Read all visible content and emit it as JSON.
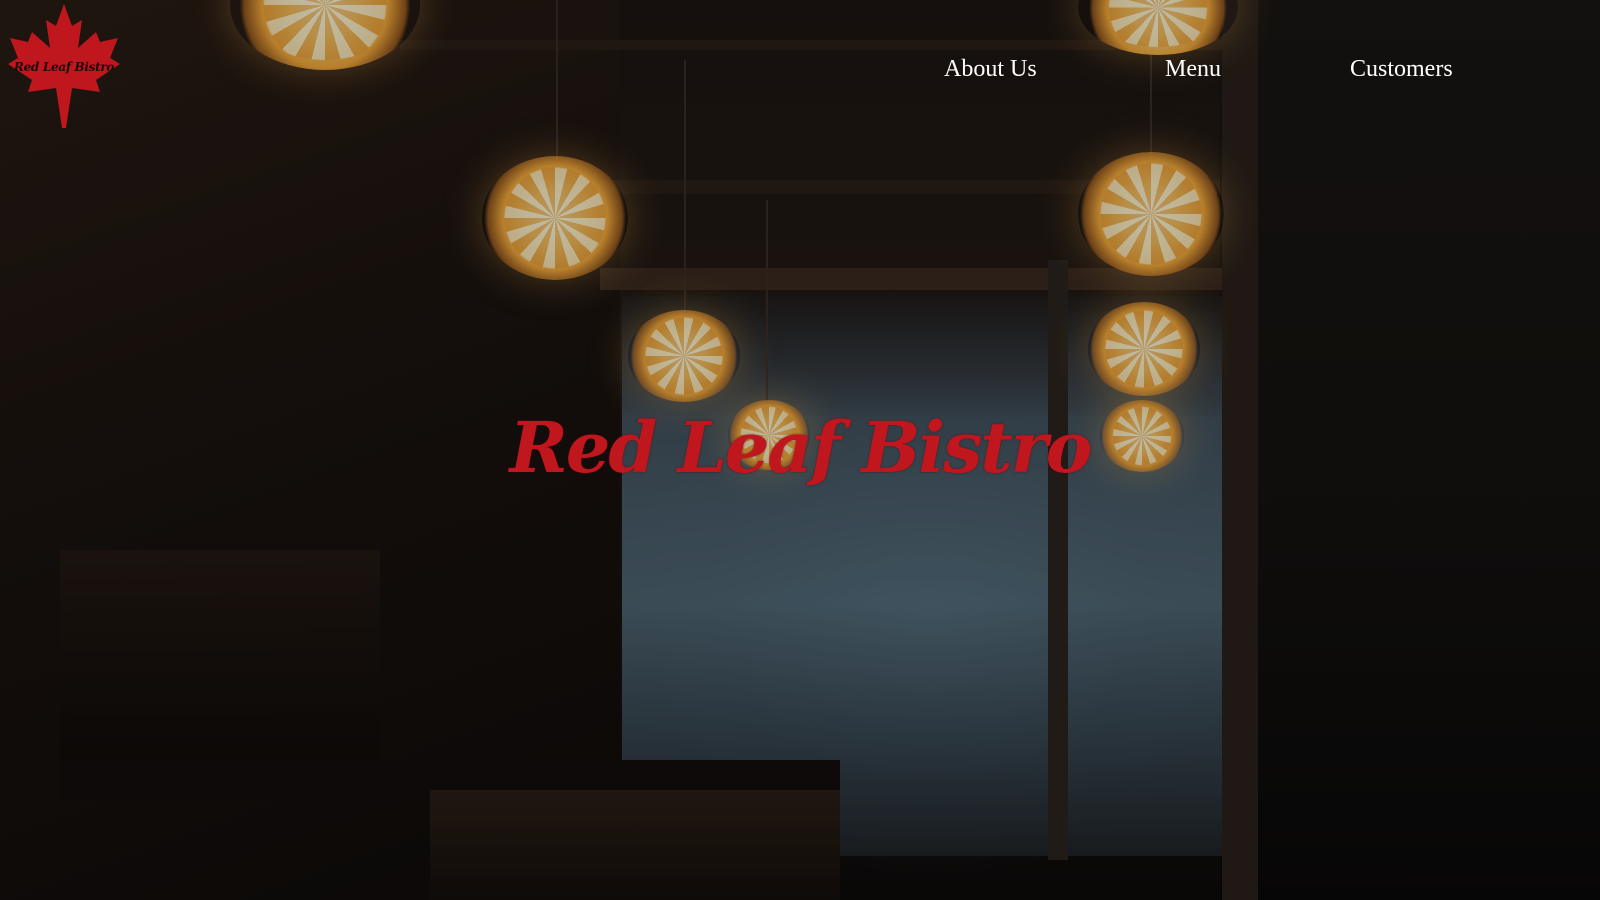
{
  "site": {
    "logo_text": "Red Leaf Bistro",
    "brand_color": "#c0161e"
  },
  "nav": {
    "items": [
      {
        "label": "About Us"
      },
      {
        "label": "Menu"
      },
      {
        "label": "Customers"
      }
    ]
  },
  "hero": {
    "title": "Red Leaf Bistro",
    "background": "dim cafe interior with pendant lamps"
  },
  "icons": {
    "logo": "maple-leaf-icon"
  }
}
